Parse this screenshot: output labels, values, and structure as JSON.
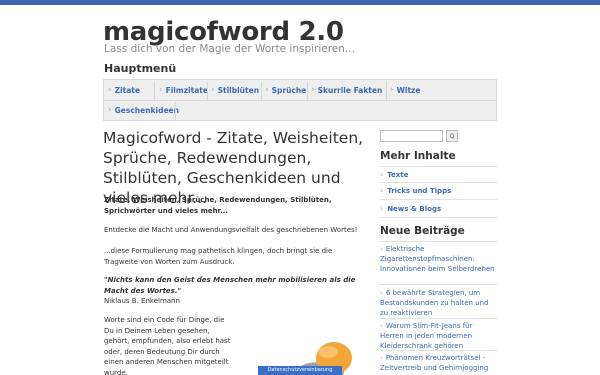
{
  "site": {
    "title": "magicofword 2.0",
    "description": "Lass dich von der Magie der Worte inspirieren..."
  },
  "menu": {
    "heading": "Hauptmenü",
    "items": [
      "Zitate",
      "Filmzitate",
      "Stilblüten",
      "Sprüche",
      "Skurrile Fakten",
      "Witze",
      "Geschenkideen"
    ]
  },
  "post": {
    "title": "Magicofword - Zitate, Weisheiten, Sprüche, Redewendungen, Stilblüten, Geschenkideen und vieles mehr...",
    "intro_bold": "Zitate, Weisheiten, Sprüche, Redewendungen, Stilblüten, Sprichwörter und vieles mehr...",
    "p1": "Entdecke die Macht und Anwendungsvielfalt des geschriebenen Wortes!",
    "p2": "...diese Formulierung mag pathetisch klingen, doch bringt sie die Tragweite von Worten zum Ausdruck.",
    "quote": "\"Nichts kann den Geist des Menschen mehr mobilisieren als die Macht des Wortes.\"",
    "quote_author": "Niklaus B. Enkelmann",
    "p3": "Worte sind ein Code für Dinge, die Du in Deinem Leben gesehen, gehört, empfunden, also erlebt hast oder, deren Bedeutung Dir durch einen anderen Menschen mitgeteilt wurde.",
    "image_label": "Datenschutzvereinbarung"
  },
  "sidebar": {
    "search_button": "Q",
    "more_heading": "Mehr Inhalte",
    "more_links": [
      "Texte",
      "Tricks und Tipps",
      "News & Blogs"
    ],
    "new_heading": "Neue Beiträge",
    "posts": [
      "Elektrische Zigarettenstopfmaschinen: Innovationen beim Selberdrehen",
      "6 bewährte Strategien, um Bestandskunden zu halten und zu reaktivieren",
      "Warum Slim-Fit-Jeans für Herren in jeden modernen Kleiderschrank gehören",
      "Phänomen Kreuzworträtsel - Zeitvertreib und Gehirnjogging"
    ]
  },
  "colors": {
    "accent": "#3f63b0",
    "link": "#3b6ab0",
    "menu_bg": "#eeeeee"
  }
}
